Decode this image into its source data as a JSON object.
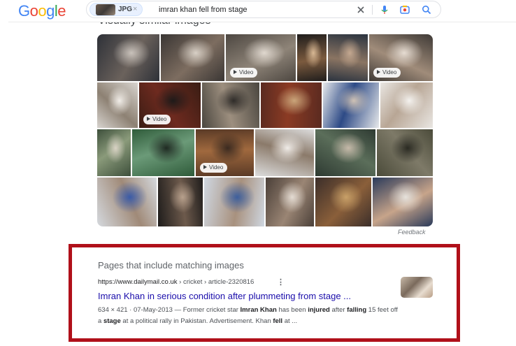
{
  "header": {
    "logo_letters": [
      {
        "ch": "G",
        "color": "#4285f4"
      },
      {
        "ch": "o",
        "color": "#ea4335"
      },
      {
        "ch": "o",
        "color": "#fbbc05"
      },
      {
        "ch": "g",
        "color": "#4285f4"
      },
      {
        "ch": "l",
        "color": "#34a853"
      },
      {
        "ch": "e",
        "color": "#ea4335"
      }
    ],
    "chip_label": "JPG",
    "chip_close": "×",
    "query": "imran khan fell from stage",
    "icons": [
      "clear-icon",
      "mic-icon",
      "lens-icon",
      "search-icon"
    ]
  },
  "visually_similar": {
    "heading": "Visually similar images",
    "video_label": "Video",
    "feedback": "Feedback",
    "tiles": [
      {
        "colors": [
          "#2e3138",
          "#6b625c",
          "#c9c2bb"
        ],
        "video": false
      },
      {
        "colors": [
          "#3a3634",
          "#7d6d60",
          "#d8d0c6"
        ],
        "video": false
      },
      {
        "colors": [
          "#4d4741",
          "#8e8478",
          "#e0d8cf"
        ],
        "video": true
      },
      {
        "colors": [
          "#1f1d1c",
          "#7b5a3e",
          "#d8b894"
        ],
        "video": false
      },
      {
        "colors": [
          "#2b3440",
          "#8a7462",
          "#c4a890"
        ],
        "video": false
      },
      {
        "colors": [
          "#3f3a36",
          "#a08c7a",
          "#e6dcd2"
        ],
        "video": true
      },
      {
        "colors": [
          "#d8d4cf",
          "#8d8173",
          "#f1ede8"
        ],
        "video": false
      },
      {
        "colors": [
          "#3a1d14",
          "#6e2a1f",
          "#1e1a19"
        ],
        "video": true
      },
      {
        "colors": [
          "#4a463f",
          "#9d8f7f",
          "#2f2c29"
        ],
        "video": false
      },
      {
        "colors": [
          "#5a2a20",
          "#8b3b24",
          "#caa57a"
        ],
        "video": false
      },
      {
        "colors": [
          "#e6e8ea",
          "#2d4a86",
          "#cfc2b5"
        ],
        "video": false
      },
      {
        "colors": [
          "#e9e6e2",
          "#b8a695",
          "#f4f2ef"
        ],
        "video": false
      },
      {
        "colors": [
          "#3d4f3b",
          "#8a9a7a",
          "#d8d2c4"
        ],
        "video": false
      },
      {
        "colors": [
          "#2f5b3a",
          "#6b9a78",
          "#1f2a22"
        ],
        "video": false
      },
      {
        "colors": [
          "#5a3a26",
          "#a0693e",
          "#3a2a20"
        ],
        "video": true
      },
      {
        "colors": [
          "#dcdcdc",
          "#8b7a6a",
          "#f0ece8"
        ],
        "video": false
      },
      {
        "colors": [
          "#2e3a32",
          "#5b6e5a",
          "#c5b9a9"
        ],
        "video": false
      },
      {
        "colors": [
          "#4b4b3a",
          "#7e7a68",
          "#2a2a22"
        ],
        "video": false
      },
      {
        "colors": [
          "#d5d9de",
          "#a08a78",
          "#3a5ba8"
        ],
        "video": false
      },
      {
        "colors": [
          "#1e1c1b",
          "#6d5a4c",
          "#b7a08c"
        ],
        "video": false
      },
      {
        "colors": [
          "#cfd7e1",
          "#a8917e",
          "#3d5f9d"
        ],
        "video": false
      },
      {
        "colors": [
          "#4a3f38",
          "#9a8574",
          "#e4dcd3"
        ],
        "video": false
      },
      {
        "colors": [
          "#3b2e2a",
          "#8a5f3a",
          "#c8a068"
        ],
        "video": false
      },
      {
        "colors": [
          "#2a3a5a",
          "#c7a48a",
          "#e6e2dc"
        ],
        "video": false
      }
    ]
  },
  "matching_pages": {
    "heading": "Pages that include matching images",
    "url_domain": "https://www.dailymail.co.uk",
    "url_path": " › cricket › article-2320816",
    "more_icon": "⋮",
    "title": "Imran Khan in serious condition after plummeting from stage ...",
    "snippet": [
      {
        "text": "634 × 421 · 07-May-2013 — Former cricket star ",
        "bold": false
      },
      {
        "text": "Imran Khan",
        "bold": true
      },
      {
        "text": " has been ",
        "bold": false
      },
      {
        "text": "injured",
        "bold": true
      },
      {
        "text": " after ",
        "bold": false
      },
      {
        "text": "falling",
        "bold": true
      },
      {
        "text": " 15 feet off a ",
        "bold": false
      },
      {
        "text": "stage",
        "bold": true
      },
      {
        "text": " at a political rally in Pakistan. Advertisement. Khan ",
        "bold": false
      },
      {
        "text": "fell",
        "bold": true
      },
      {
        "text": " at ...",
        "bold": false
      }
    ]
  },
  "colors": {
    "highlight_border": "#b0101a",
    "link": "#1a0dab"
  }
}
